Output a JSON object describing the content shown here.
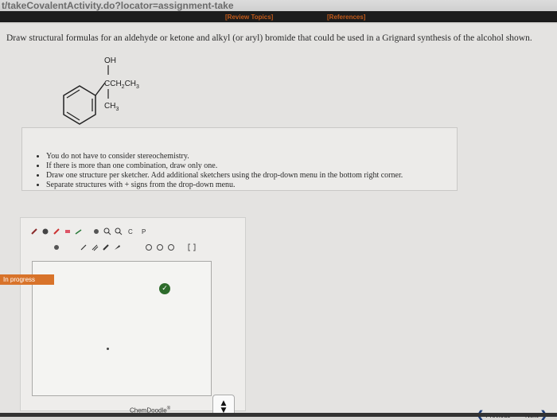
{
  "browser": {
    "url_fragment": "t/takeCovalentActivity.do?locator=assignment-take"
  },
  "header": {
    "review_topics": "[Review Topics]",
    "references": "[References]"
  },
  "question": {
    "prompt": "Draw structural formulas for an aldehyde or ketone and alkyl (or aryl) bromide that could be used in a Grignard synthesis of the alcohol shown.",
    "molecule": {
      "oh": "OH",
      "ethyl_c": "CCH",
      "ethyl_2": "2",
      "ethyl_ch": "CH",
      "ethyl_3": "3",
      "methyl": "CH",
      "methyl_3": "3"
    }
  },
  "instructions": [
    "You do not have to consider stereochemistry.",
    "If there is more than one combination, draw only one.",
    "Draw one structure per sketcher. Add additional sketchers using the drop-down menu in the bottom right corner.",
    "Separate structures with + signs from the drop-down menu."
  ],
  "sketcher": {
    "status": "In progress",
    "brand": "ChemDoodle",
    "brand_mark": "®",
    "stepper": {
      "up": "▲",
      "down": "▼"
    },
    "tool_icons": [
      "bond-icon",
      "template-icon",
      "eraser-icon",
      "arrow-icon",
      "lasso-icon",
      "zoom-in-icon",
      "zoom-out-icon",
      "charge-icon",
      "periodic-table-icon"
    ],
    "colors": {
      "status_bg": "#d8732a",
      "check_bg": "#2d6b2b"
    }
  },
  "nav": {
    "previous": "Previous",
    "next": "Next"
  },
  "colors": {
    "link": "#c35a1a",
    "nav_chevron": "#1f3f7a"
  }
}
